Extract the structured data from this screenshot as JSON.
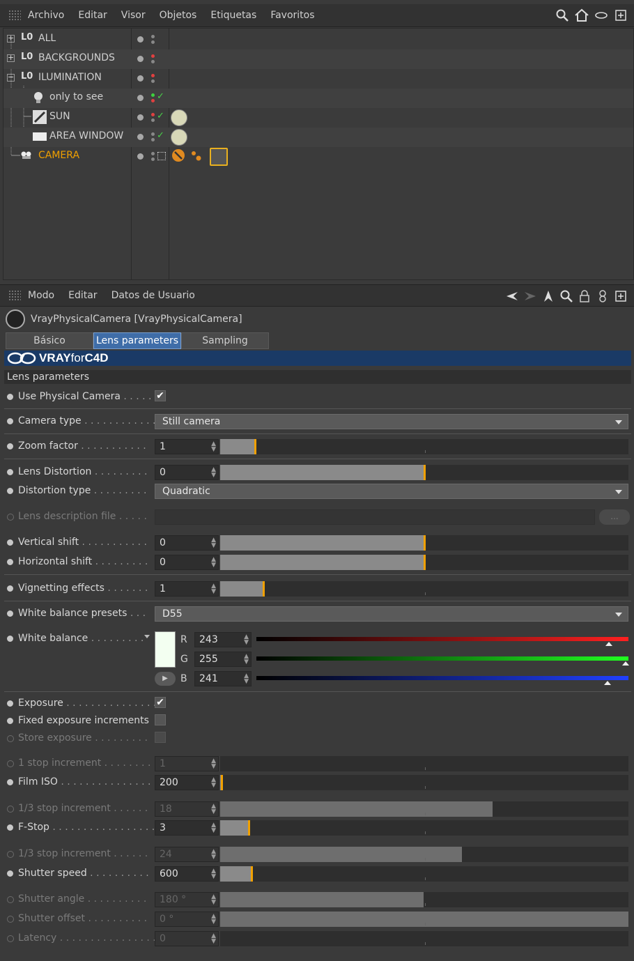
{
  "object_manager": {
    "menu": [
      "Archivo",
      "Editar",
      "Visor",
      "Objetos",
      "Etiquetas",
      "Favoritos"
    ],
    "objects": [
      {
        "name": "ALL",
        "kind": "layer"
      },
      {
        "name": "BACKGROUNDS",
        "kind": "layer"
      },
      {
        "name": "ILUMINATION",
        "kind": "layer"
      },
      {
        "name": "only to see",
        "kind": "light"
      },
      {
        "name": "SUN",
        "kind": "sun"
      },
      {
        "name": "AREA WINDOW",
        "kind": "area"
      },
      {
        "name": "CAMERA",
        "kind": "camera",
        "selected": true
      }
    ],
    "layer_prefix": "L0"
  },
  "attribute_manager": {
    "menu": [
      "Modo",
      "Editar",
      "Datos de Usuario"
    ],
    "object_title": "VrayPhysicalCamera [VrayPhysicalCamera]",
    "tabs": [
      {
        "label": "Básico",
        "active": false
      },
      {
        "label": "Lens parameters",
        "active": true
      },
      {
        "label": "Sampling",
        "active": false
      }
    ],
    "banner": {
      "bold": "VRAY",
      "thin": "for",
      "bold2": "C4D"
    },
    "section_title": "Lens parameters",
    "params": {
      "use_physical_camera": {
        "label": "Use Physical Camera",
        "dots": " . . . . .",
        "checked": true,
        "check": "✔"
      },
      "camera_type": {
        "label": "Camera type",
        "dots": " . . . . . . . . . . . .",
        "value": "Still camera"
      },
      "zoom_factor": {
        "label": "Zoom factor",
        "dots": " . . . . . . . . . . .",
        "value": "1",
        "fill": 0.085
      },
      "lens_distortion": {
        "label": "Lens Distortion",
        "dots": " . . . . . . . . .",
        "value": "0",
        "fill": 0.5
      },
      "distortion_type": {
        "label": "Distortion type",
        "dots": " . . . . . . . . .",
        "value": "Quadratic"
      },
      "lens_description_file": {
        "label": "Lens description file",
        "dots": " . . . . .",
        "button": "..."
      },
      "vertical_shift": {
        "label": "Vertical shift",
        "dots": " . . . . . . . . . . .",
        "value": "0",
        "fill": 0.5
      },
      "horizontal_shift": {
        "label": "Horizontal shift",
        "dots": " . . . . . . . . .",
        "value": "0",
        "fill": 0.5
      },
      "vignetting_effects": {
        "label": "Vignetting effects",
        "dots": " . . . . . . .",
        "value": "1",
        "fill": 0.105
      },
      "white_balance_presets": {
        "label": "White balance presets",
        "dots": " . . .",
        "value": "D55"
      },
      "white_balance": {
        "label": "White balance",
        "dots": " . . . . . . . . .",
        "r": "243",
        "g": "255",
        "b": "241",
        "r_label": "R",
        "g_label": "G",
        "b_label": "B",
        "swatch": "#f3fff1"
      },
      "exposure": {
        "label": "Exposure",
        "dots": " . . . . . . . . . . . . . . .",
        "checked": true,
        "check": "✔"
      },
      "fixed_exposure_increments": {
        "label": "Fixed exposure increments",
        "checked": false
      },
      "store_exposure": {
        "label": "Store exposure",
        "dots": " . . . . . . . . .",
        "checked": false
      },
      "stop_increment": {
        "label": "1 stop increment",
        "dots": " . . . . . . . .",
        "value": "1",
        "fill": 0
      },
      "film_iso": {
        "label": "Film ISO",
        "dots": " . . . . . . . . . . . . . . . .",
        "value": "200",
        "fill": 0.004
      },
      "third_stop_increment_1": {
        "label": "1/3 stop increment",
        "dots": " . . . . . .",
        "value": "18",
        "fill": 0.667
      },
      "f_stop": {
        "label": "F-Stop",
        "dots": " . . . . . . . . . . . . . . . . .",
        "value": "3",
        "fill": 0.07
      },
      "third_stop_increment_2": {
        "label": "1/3 stop increment",
        "dots": " . . . . . .",
        "value": "24",
        "fill": 0.592
      },
      "shutter_speed": {
        "label": "Shutter speed",
        "dots": " . . . . . . . . . .",
        "value": "600",
        "fill": 0.076
      },
      "shutter_angle": {
        "label": "Shutter angle",
        "dots": " . . . . . . . . . .",
        "value": "180 °",
        "fill": 0.498
      },
      "shutter_offset": {
        "label": "Shutter offset",
        "dots": " . . . . . . . . . .",
        "value": "0 °",
        "fill": 1.0
      },
      "latency": {
        "label": "Latency",
        "dots": " . . . . . . . . . . . . . . . . . .",
        "value": "0",
        "fill": 0
      }
    }
  },
  "colors": {
    "accent": "#f0a000",
    "tab_active": "#3f6da8",
    "banner": "#1a3a66"
  }
}
